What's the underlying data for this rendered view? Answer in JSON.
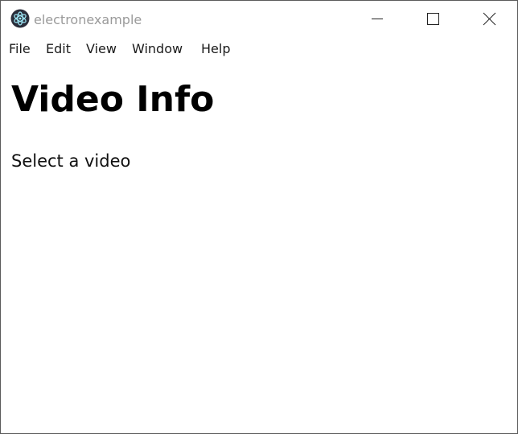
{
  "window": {
    "title": "electronexample",
    "icon": "electron-atom-icon",
    "controls": [
      "minimize-icon",
      "maximize-icon",
      "close-icon"
    ]
  },
  "menubar": {
    "items": [
      {
        "label": "File"
      },
      {
        "label": "Edit"
      },
      {
        "label": "View"
      },
      {
        "label": "Window"
      },
      {
        "label": "Help"
      }
    ]
  },
  "main": {
    "heading": "Video Info",
    "prompt": "Select a video"
  }
}
